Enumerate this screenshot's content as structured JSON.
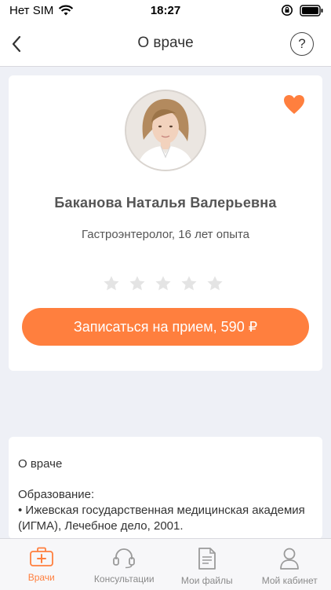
{
  "status_bar": {
    "carrier": "Нет SIM",
    "time": "18:27"
  },
  "nav": {
    "title": "О враче",
    "help_label": "?"
  },
  "doctor": {
    "name": "Баканова Наталья Валерьевна",
    "specialty": "Гастроэнтеролог, 16 лет опыта",
    "rating": 0,
    "rating_max": 5,
    "favorite": true,
    "book_button": "Записаться на прием, 590 ₽"
  },
  "about": {
    "heading": "О враче",
    "education_label": "Образование:",
    "education_item": "• Ижевская государственная медицинская академия (ИГМА), Лечебное дело, 2001."
  },
  "tabs": [
    {
      "label": "Врачи",
      "icon": "first-aid-kit-icon",
      "active": true
    },
    {
      "label": "Консультации",
      "icon": "headset-icon",
      "active": false
    },
    {
      "label": "Мои файлы",
      "icon": "document-icon",
      "active": false
    },
    {
      "label": "Мой кабинет",
      "icon": "user-icon",
      "active": false
    }
  ],
  "colors": {
    "accent": "#ff7f3e",
    "background": "#eef0f6",
    "star_empty": "#e4e4e4"
  }
}
